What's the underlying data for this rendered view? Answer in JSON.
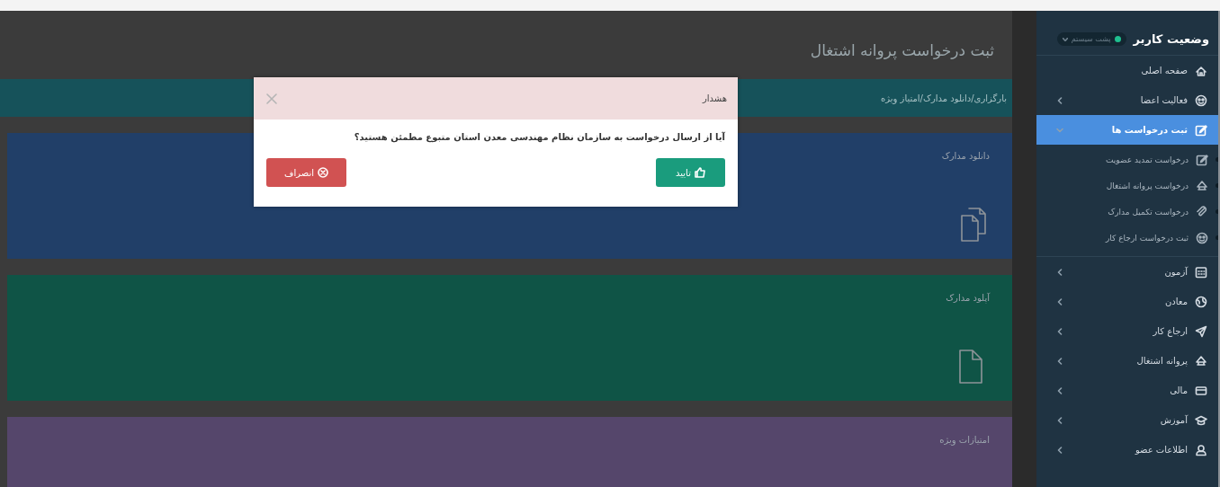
{
  "page_title": "ثبت درخواست پروانه اشتغال",
  "breadcrumb": "بارگزاری/دانلود مدارک/امتیاز ویژه",
  "cards": [
    {
      "title": "دانلود مدارک",
      "color": "#213f68"
    },
    {
      "title": "آپلود مدارک",
      "color": "#0f5446"
    },
    {
      "title": "امتیازات ویژه",
      "color": "#55466b"
    }
  ],
  "sidebar": {
    "title": "وضعیت کاربر",
    "status": {
      "label": "پشت سیستم",
      "online": true
    },
    "items": [
      {
        "label": "صفحه اصلی",
        "selected": false
      },
      {
        "label": "فعالیت اعضا",
        "selected": false,
        "expanded": false
      },
      {
        "label": "ثبت درخواست ها",
        "selected": true,
        "expanded": true,
        "children": [
          {
            "label": "درخواست تمدید عضویت"
          },
          {
            "label": "درخواست پروانه اشتغال"
          },
          {
            "label": "درخواست تکمیل مدارک"
          },
          {
            "label": "ثبت درخواست ارجاع کار"
          }
        ]
      },
      {
        "label": "آزمون",
        "selected": false,
        "expanded": false
      },
      {
        "label": "معادن",
        "selected": false,
        "expanded": false
      },
      {
        "label": "ارجاع کار",
        "selected": false,
        "expanded": false
      },
      {
        "label": "پروانه اشتغال",
        "selected": false,
        "expanded": false
      },
      {
        "label": "مالی",
        "selected": false,
        "expanded": false
      },
      {
        "label": "آموزش",
        "selected": false,
        "expanded": false
      },
      {
        "label": "اطلاعات عضو",
        "selected": false,
        "expanded": false
      }
    ]
  },
  "dialog": {
    "title": "هشدار",
    "message": "آیا از ارسال درخواست به سازمان نظام مهندسی معدن استان متبوع مطمئن هستید؟",
    "buttons": [
      {
        "label": "تایید",
        "kind": "confirm"
      },
      {
        "label": "انصراف",
        "kind": "cancel"
      }
    ]
  }
}
